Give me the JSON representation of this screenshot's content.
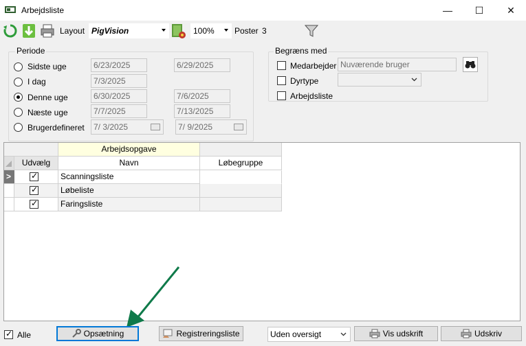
{
  "window": {
    "title": "Arbejdsliste",
    "minimize": "—",
    "maximize": "☐",
    "close": "✕"
  },
  "toolbar": {
    "layout_label": "Layout",
    "layout_value": "PigVision",
    "zoom_value": "100%",
    "poster_label": "Poster",
    "poster_value": "3"
  },
  "periode": {
    "title": "Periode",
    "rows": [
      {
        "label": "Sidste uge",
        "from": "6/23/2025",
        "to": "6/29/2025",
        "checked": false
      },
      {
        "label": "I dag",
        "from": "7/3/2025",
        "to": "",
        "checked": false
      },
      {
        "label": "Denne uge",
        "from": "6/30/2025",
        "to": "7/6/2025",
        "checked": true
      },
      {
        "label": "Næste uge",
        "from": "7/7/2025",
        "to": "7/13/2025",
        "checked": false
      },
      {
        "label": "Brugerdefineret",
        "from": " 7/  3/2025",
        "to": " 7/  9/2025",
        "checked": false
      }
    ]
  },
  "begraens": {
    "title": "Begræns med",
    "medarbejder_label": "Medarbejder",
    "medarbejder_value": "Nuværende bruger",
    "dyrtype_label": "Dyrtype",
    "arbejdsliste_label": "Arbejdsliste"
  },
  "grid": {
    "band_header": "Arbejdsopgave",
    "columns": [
      "Udvælg",
      "Navn",
      "Løbegruppe"
    ],
    "rows": [
      {
        "name": "Scanningsliste",
        "checked": true,
        "group": ""
      },
      {
        "name": "Løbeliste",
        "checked": true,
        "group": ""
      },
      {
        "name": "Faringsliste",
        "checked": true,
        "group": ""
      }
    ],
    "row_indicator": ">"
  },
  "bottom": {
    "alle_label": "Alle",
    "opsaetning_label": "Opsætning",
    "registrering_label": "Registreringsliste",
    "oversigt_value": "Uden oversigt",
    "vis_udskrift_label": "Vis udskrift",
    "udskriv_label": "Udskriv"
  },
  "colors": {
    "accent": "#0078d7",
    "annotation_arrow": "#0f7a4a",
    "grid_band_header": "#ffffe0"
  }
}
